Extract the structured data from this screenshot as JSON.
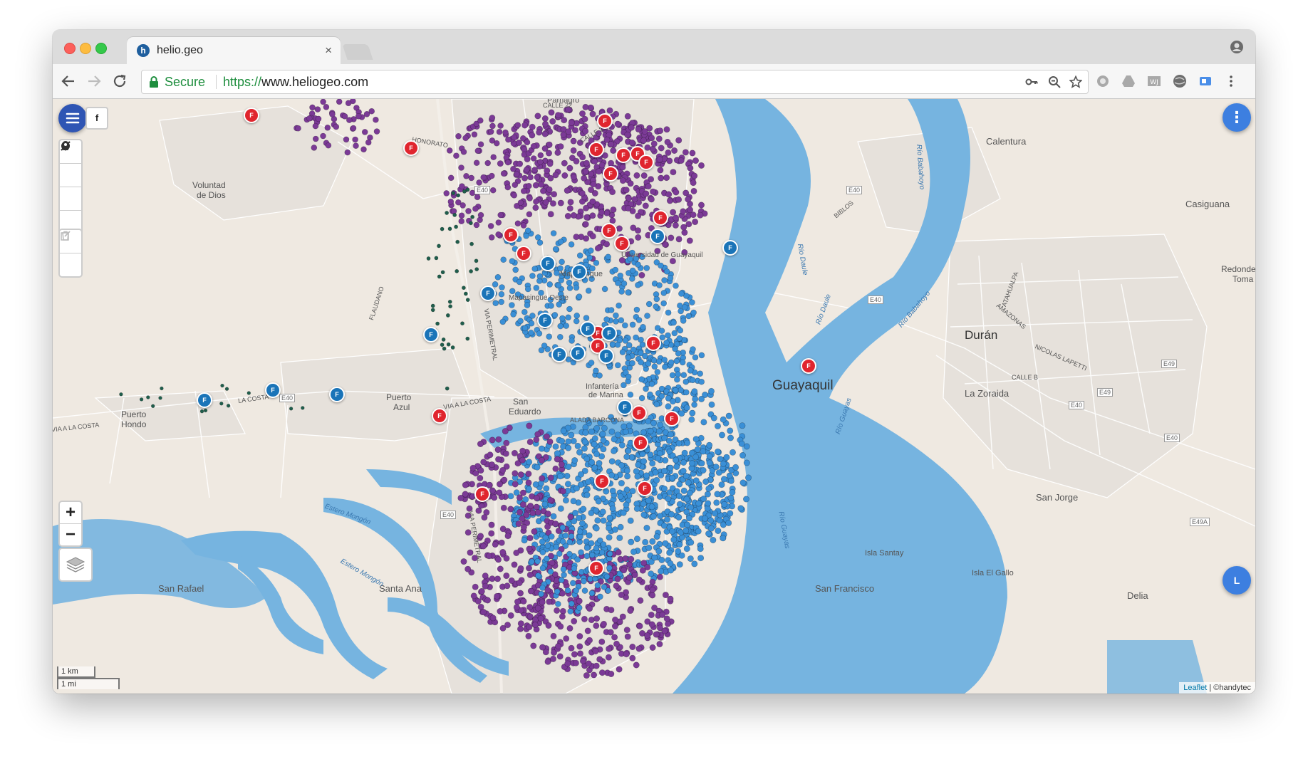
{
  "browser": {
    "tab_title": "helio.geo",
    "tab_favicon": "h",
    "tab_close": "×",
    "secure_label": "Secure",
    "url_scheme": "https://",
    "url_host": "www.heliogeo.com"
  },
  "map": {
    "menu_button_label": "menu",
    "f_button_label": "f",
    "more_button_label": "⋮",
    "user_button_label": "L",
    "zoom_in_label": "+",
    "zoom_out_label": "−",
    "scale_km": "1 km",
    "scale_mi": "1 mi",
    "attribution_leaflet": "Leaflet",
    "attribution_sep": " | ",
    "attribution_tiles": "©handytec",
    "marker_label": "F",
    "colors": {
      "water": "#76b4e0",
      "land": "#efe9e1",
      "park": "#c9dfa0",
      "purple_points": "#7b3a96",
      "blue_points": "#3a8fd6",
      "teal_points": "#1f5e4c",
      "red_marker": "#e0252e",
      "blue_marker": "#1a74b8",
      "fab": "#3d7fe0"
    },
    "place_labels": [
      {
        "text": "Calentura"
      },
      {
        "text": "Casiguana"
      },
      {
        "text": "Redondel"
      },
      {
        "text": "Toma"
      },
      {
        "text": "Voluntad"
      },
      {
        "text": "de Dios"
      },
      {
        "text": "Durán"
      },
      {
        "text": "La Zoraida"
      },
      {
        "text": "Guayaquil"
      },
      {
        "text": "Infantería"
      },
      {
        "text": "de Marina"
      },
      {
        "text": "San"
      },
      {
        "text": "Eduardo"
      },
      {
        "text": "Puerto"
      },
      {
        "text": "Azul"
      },
      {
        "text": "Puerto"
      },
      {
        "text": "Hondo"
      },
      {
        "text": "San Rafael"
      },
      {
        "text": "Santa Ana"
      },
      {
        "text": "San Francisco"
      },
      {
        "text": "Isla Santay"
      },
      {
        "text": "Isla El Gallo"
      },
      {
        "text": "San Jorge"
      },
      {
        "text": "Delia"
      },
      {
        "text": "Parnagro"
      },
      {
        "text": "Mapasingue"
      },
      {
        "text": "Universidad de Guayaquil"
      },
      {
        "text": "Mapasingue Oeste"
      }
    ],
    "road_labels": [
      "E40",
      "E40",
      "E40",
      "E40",
      "E40",
      "E40",
      "E49",
      "E49",
      "E49A",
      "E40"
    ],
    "street_labels": [
      "VIA A LA COSTA",
      "LA COSTA",
      "VIA A LA COSTA",
      "VIA PERIMETRAL",
      "VIA PERIMETRAL",
      "CALLE B",
      "NICOLAS LAPETTI",
      "AMAZONAS",
      "ATAHUALPA",
      "BIBLOS",
      "HONORATO",
      "CALLE 22",
      "CALLE 21",
      "FLAUDANO",
      "ALADA BARCONA"
    ],
    "water_labels": [
      "Río Daule",
      "Río Daule",
      "Río Babahoyo",
      "Río Babahoyo",
      "Río Guayas",
      "Río Guayas",
      "Estero Mongón",
      "Estero Mongón"
    ]
  }
}
